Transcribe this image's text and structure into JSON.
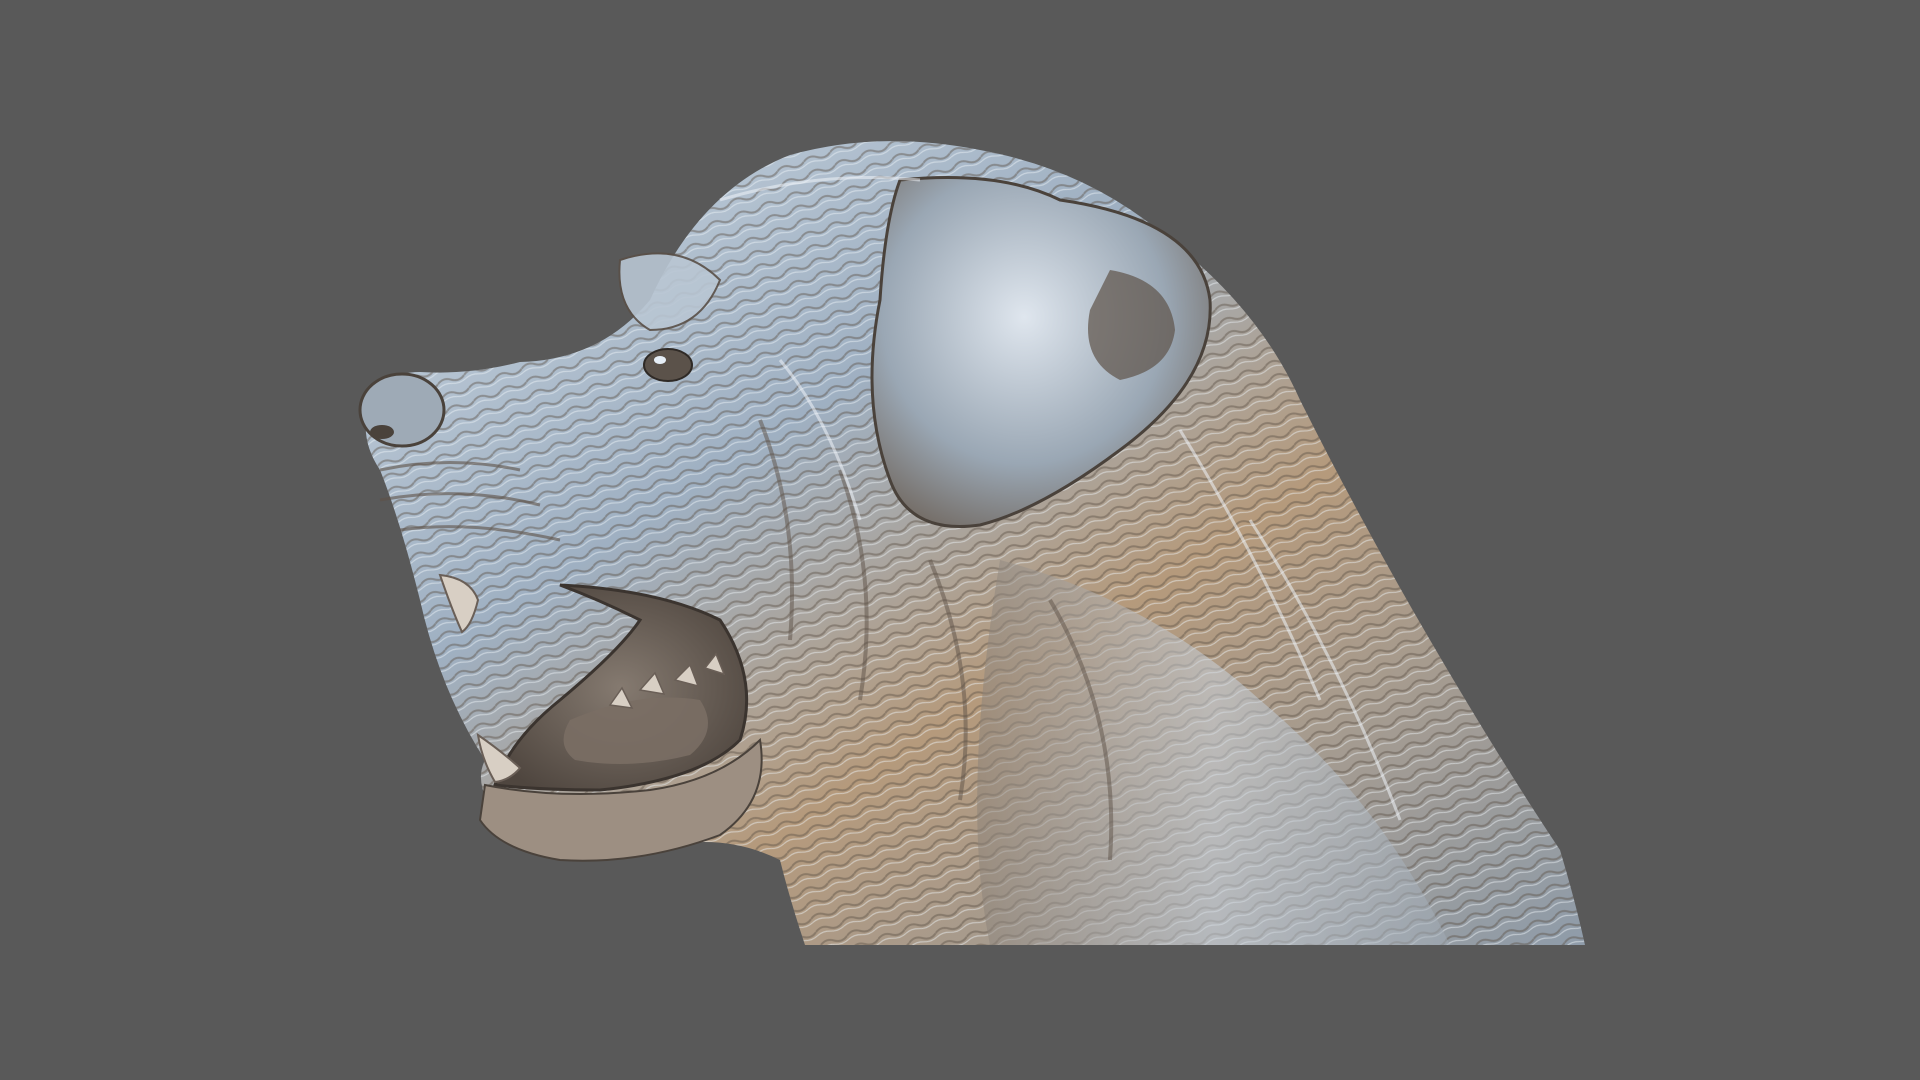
{
  "viewport": {
    "background_color": "#595959"
  },
  "model": {
    "subject": "dog-head-sculpt",
    "material_colors": {
      "highlight": "#e6eef6",
      "mid": "#9fb0c2",
      "shadow": "#5e5248",
      "warm": "#b59a7c",
      "mouth": "#6a5f57",
      "teeth": "#d8cfc4"
    }
  }
}
